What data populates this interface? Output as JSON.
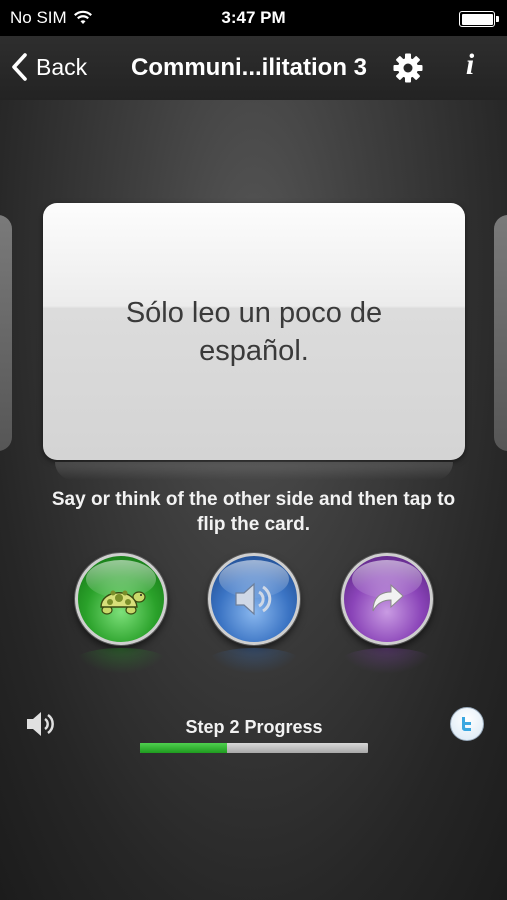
{
  "status_bar": {
    "carrier": "No SIM",
    "time": "3:47 PM",
    "battery_level": 1.0
  },
  "nav": {
    "back_label": "Back",
    "title": "Communi...ilitation 3",
    "icons": [
      "chevron-left-icon",
      "gear-icon",
      "info-icon"
    ],
    "info_glyph": "i"
  },
  "card": {
    "text": "Sólo leo un poco de español."
  },
  "instruction": "Say or think of the other side and then tap to flip the card.",
  "buttons": [
    {
      "name": "slow-turtle-button",
      "icon": "turtle-icon",
      "color": "#2aa12a"
    },
    {
      "name": "play-audio-button",
      "icon": "speaker-icon",
      "color": "#3a73c3"
    },
    {
      "name": "flip-card-button",
      "icon": "curved-arrow-icon",
      "color": "#8a44b8"
    }
  ],
  "footer": {
    "progress_label": "Step 2 Progress",
    "progress_fraction": 0.38,
    "sound_icon": "speaker-icon",
    "share_icon": "twitter-icon"
  },
  "colors": {
    "progress_fill": "#2fae2f",
    "progress_track": "#bdbdbd",
    "background": "#3a3a3a"
  }
}
